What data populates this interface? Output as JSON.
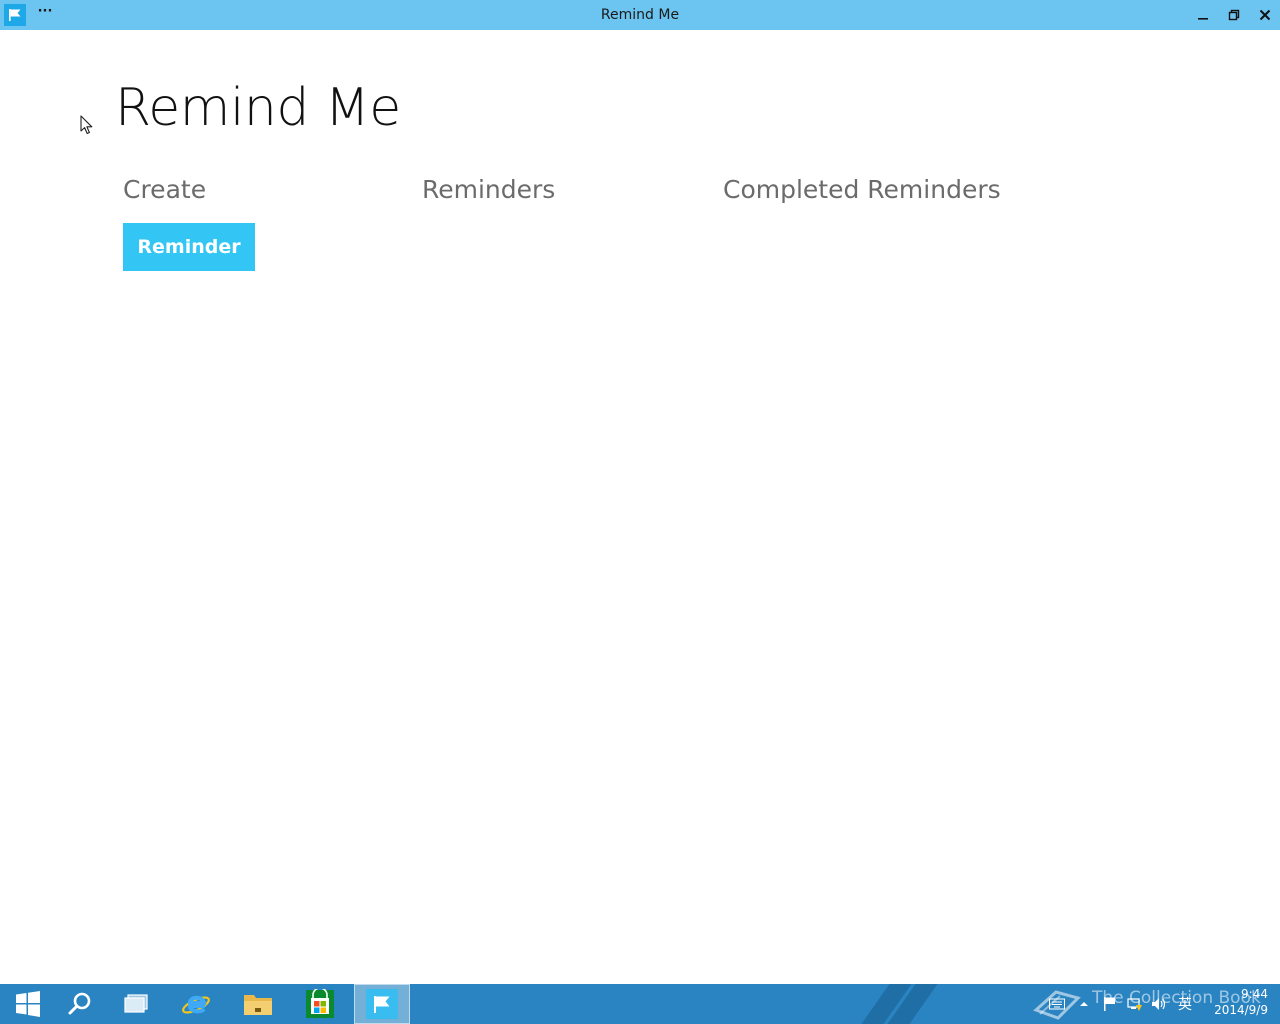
{
  "window": {
    "title": "Remind Me",
    "menu_label": "···",
    "accent": "#6cc4f0"
  },
  "app": {
    "title": "Remind Me",
    "sections": {
      "create": "Create",
      "reminders": "Reminders",
      "completed": "Completed Reminders"
    },
    "reminder_button": "Reminder",
    "button_color": "#33c6f4"
  },
  "taskbar": {
    "color": "#2a84c2",
    "pinned": [
      {
        "name": "start",
        "icon": "windows-logo-icon"
      },
      {
        "name": "search",
        "icon": "search-icon"
      },
      {
        "name": "task-view",
        "icon": "task-view-icon"
      },
      {
        "name": "internet-explorer",
        "icon": "internet-explorer-icon"
      },
      {
        "name": "file-explorer",
        "icon": "folder-icon"
      },
      {
        "name": "store",
        "icon": "store-icon"
      },
      {
        "name": "remind-me",
        "icon": "flag-icon",
        "active": true
      }
    ],
    "watermark": "The Collection Book",
    "ime": "英",
    "time": "9:44",
    "date": "2014/9/9"
  }
}
